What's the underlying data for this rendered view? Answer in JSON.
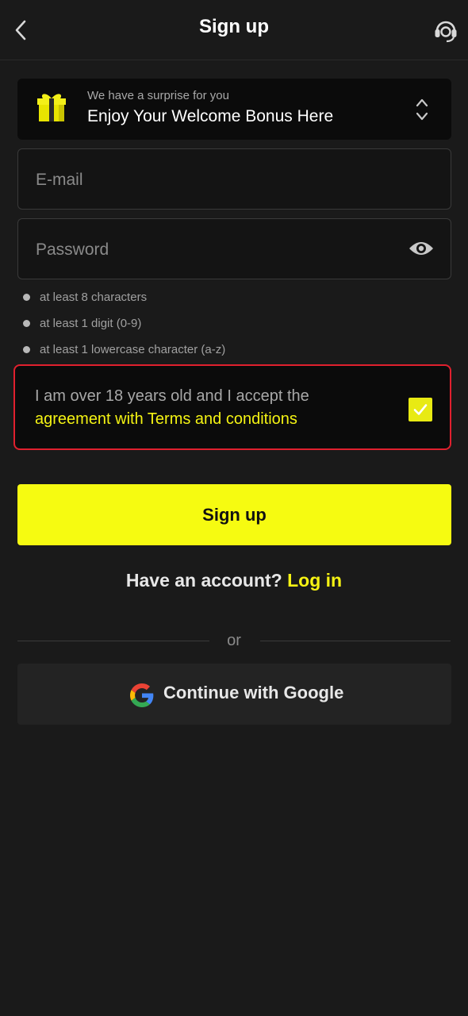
{
  "header": {
    "title": "Sign up",
    "back_icon": "chevron-left-icon",
    "support_icon": "headset-icon"
  },
  "bonus": {
    "subtitle": "We have a surprise for you",
    "title": "Enjoy Your Welcome Bonus Here",
    "icon": "gift-icon",
    "toggle_icon": "chevron-up-down-icon"
  },
  "form": {
    "email_placeholder": "E-mail",
    "email_value": "",
    "password_placeholder": "Password",
    "password_value": "",
    "password_toggle_icon": "eye-icon",
    "password_rules": [
      "at least 8 characters",
      "at least 1 digit (0-9)",
      "at least 1 lowercase character (a-z)"
    ]
  },
  "agreement": {
    "text": "I am over 18 years old and I accept the",
    "link": "agreement with Terms and conditions",
    "checked": true
  },
  "signup_button": "Sign up",
  "login_prompt": {
    "text": "Have an account?",
    "link": "Log in"
  },
  "divider": "or",
  "google_button": "Continue with Google",
  "colors": {
    "background": "#1a1a1a",
    "accent": "#f6fb11",
    "error_border": "#e0202e",
    "card": "#0b0b0b"
  }
}
